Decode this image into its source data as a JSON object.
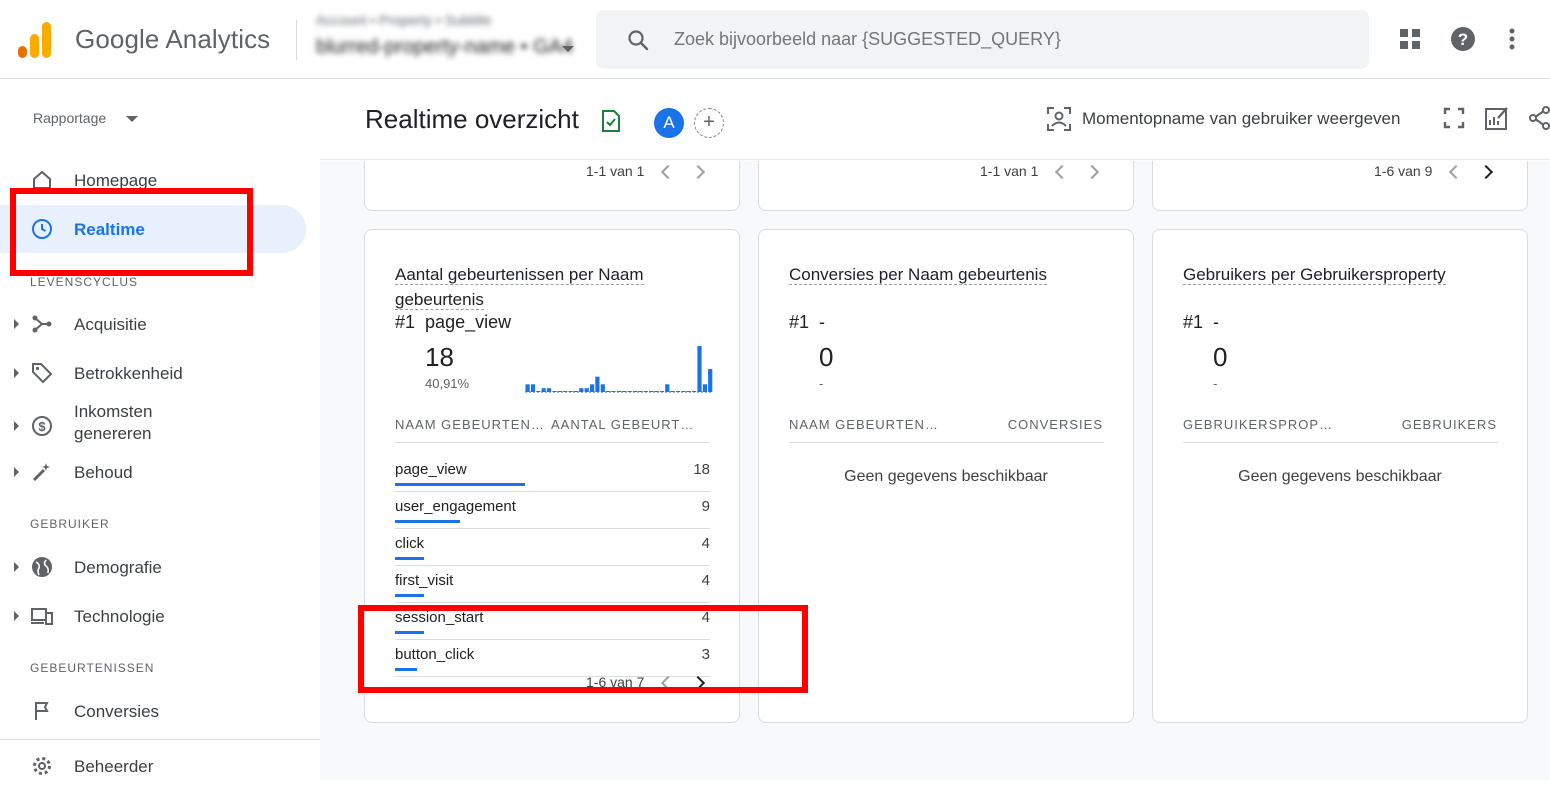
{
  "app": {
    "name": "Google Analytics"
  },
  "account": {
    "line1": "Account • Property • Subtitle",
    "line2": "blurred-property-name • GA4"
  },
  "search": {
    "placeholder": "Zoek bijvoorbeeld naar {SUGGESTED_QUERY}"
  },
  "top_icons": [
    "apps-grid-icon",
    "help-icon",
    "more-vert-icon"
  ],
  "sidebar": {
    "report_selector": "Rapportage",
    "items": [
      {
        "label": "Homepage",
        "icon": "home-icon"
      },
      {
        "label": "Realtime",
        "icon": "clock-icon",
        "active": true
      }
    ],
    "sections": [
      {
        "label": "LEVENSCYCLUS",
        "items": [
          {
            "label": "Acquisitie",
            "icon": "acquisition-icon"
          },
          {
            "label": "Betrokkenheid",
            "icon": "tag-icon"
          },
          {
            "label": "Inkomsten",
            "label2": "genereren",
            "icon": "dollar-icon"
          },
          {
            "label": "Behoud",
            "icon": "magic-wand-icon"
          }
        ]
      },
      {
        "label": "GEBRUIKER",
        "items": [
          {
            "label": "Demografie",
            "icon": "globe-icon"
          },
          {
            "label": "Technologie",
            "icon": "devices-icon"
          }
        ]
      },
      {
        "label": "GEBEURTENISSEN",
        "items": [
          {
            "label": "Conversies",
            "icon": "flag-icon"
          }
        ]
      }
    ],
    "admin": "Beheerder"
  },
  "header": {
    "title": "Realtime overzicht",
    "avatar": "A",
    "add_compare": "+",
    "snapshot_label": "Momentopname van gebruiker weergeven"
  },
  "top_cards": [
    {
      "pager": "1-1 van 1"
    },
    {
      "pager": "1-1 van 1"
    },
    {
      "pager": "1-6 van 9"
    }
  ],
  "cards": [
    {
      "title1": "Aantal gebeurtenissen per Naam",
      "title2": "gebeurtenis",
      "rank": "#1",
      "top_name": "page_view",
      "value": "18",
      "pct": "40,91%",
      "col1": "NAAM GEBEURTEN…",
      "col2": "AANTAL GEBEURT…",
      "rows": [
        {
          "name": "page_view",
          "value": "18",
          "share": 1.0
        },
        {
          "name": "user_engagement",
          "value": "9",
          "share": 0.5
        },
        {
          "name": "click",
          "value": "4",
          "share": 0.22
        },
        {
          "name": "first_visit",
          "value": "4",
          "share": 0.22
        },
        {
          "name": "session_start",
          "value": "4",
          "share": 0.22
        },
        {
          "name": "button_click",
          "value": "3",
          "share": 0.17
        }
      ],
      "pager": "1-6 van 7",
      "sparkline": [
        2,
        2,
        0,
        1,
        1,
        0,
        0,
        0,
        0,
        0,
        1,
        1,
        2,
        4,
        2,
        0,
        0,
        0,
        0,
        0,
        0,
        0,
        0,
        0,
        0,
        0,
        2,
        0,
        0,
        0,
        0,
        0,
        12,
        2,
        6
      ]
    },
    {
      "title1": "Conversies per Naam gebeurtenis",
      "rank": "#1",
      "top_name": "-",
      "value": "0",
      "pct": "-",
      "col1": "NAAM GEBEURTEN…",
      "col2": "CONVERSIES",
      "empty": "Geen gegevens beschikbaar"
    },
    {
      "title1": "Gebruikers per Gebruikersproperty",
      "rank": "#1",
      "top_name": "-",
      "value": "0",
      "pct": "-",
      "col1": "GEBRUIKERSPROP…",
      "col2": "GEBRUIKERS",
      "empty": "Geen gegevens beschikbaar"
    }
  ],
  "colors": {
    "accent": "#1a73e8",
    "highlight": "#ff0000",
    "logo_orange": "#f9ab00",
    "logo_dark_orange": "#e37400"
  }
}
